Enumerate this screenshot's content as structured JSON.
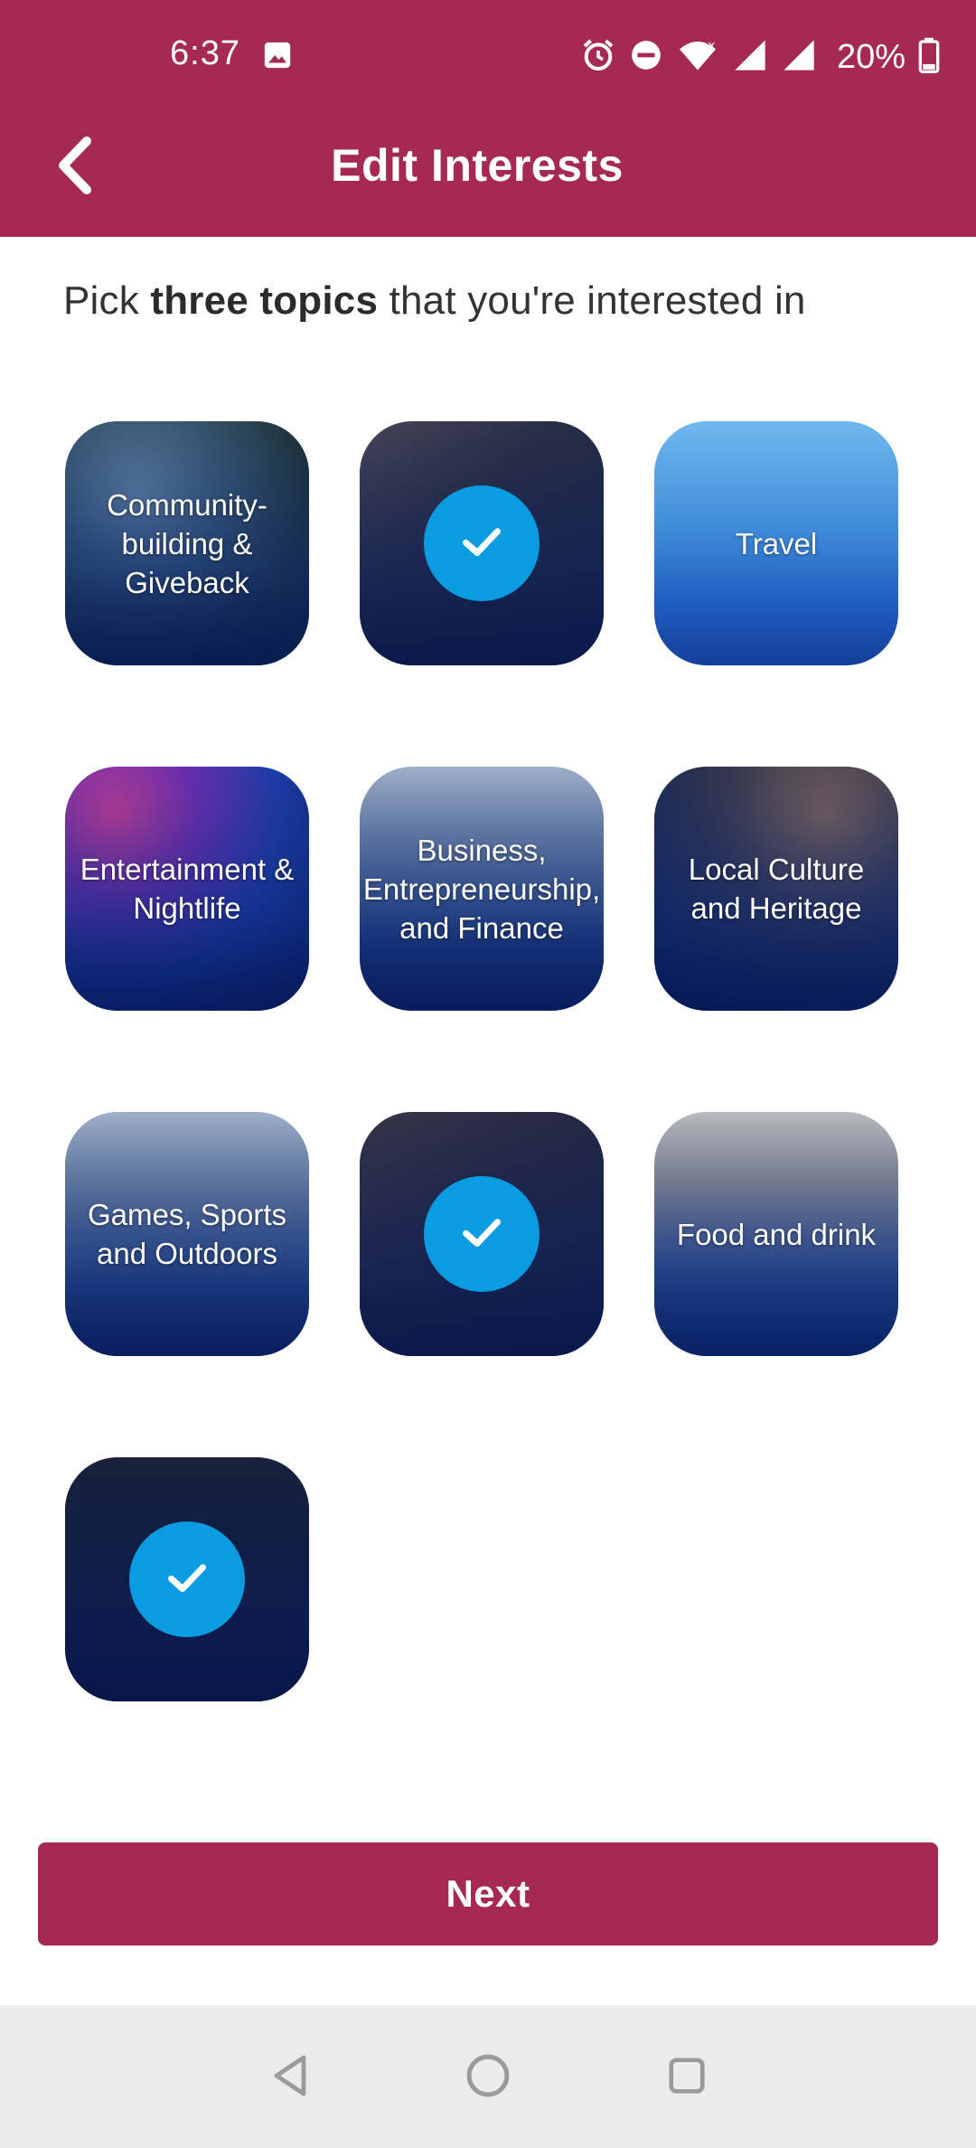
{
  "status_bar": {
    "time": "6:37",
    "battery": "20%",
    "icons": [
      "image-icon",
      "alarm-icon",
      "dnd-icon",
      "wifi-icon",
      "signal-icon",
      "signal-icon",
      "battery-icon"
    ]
  },
  "header": {
    "title": "Edit Interests",
    "back_icon": "chevron-left-icon"
  },
  "prompt": {
    "before": "Pick ",
    "bold": "three topics",
    "after": " that you're interested in"
  },
  "tiles": [
    {
      "label": "Community-building & Giveback",
      "selected": false
    },
    {
      "label": "",
      "selected": true
    },
    {
      "label": "Travel",
      "selected": false
    },
    {
      "label": "Entertainment & Nightlife",
      "selected": false
    },
    {
      "label": "Business, Entrepreneurship, and Finance",
      "selected": false
    },
    {
      "label": "Local Culture and Heritage",
      "selected": false
    },
    {
      "label": "Games, Sports and Outdoors",
      "selected": false
    },
    {
      "label": "",
      "selected": true
    },
    {
      "label": "Food and drink",
      "selected": false
    },
    {
      "label": "",
      "selected": true
    }
  ],
  "next_button": {
    "label": "Next"
  },
  "nav_bar": {
    "icons": [
      "back-triangle-icon",
      "home-circle-icon",
      "recents-square-icon"
    ]
  },
  "colors": {
    "brand": "#A62954",
    "check": "#0A9BE0",
    "nav_bg": "#EBEBEB"
  }
}
